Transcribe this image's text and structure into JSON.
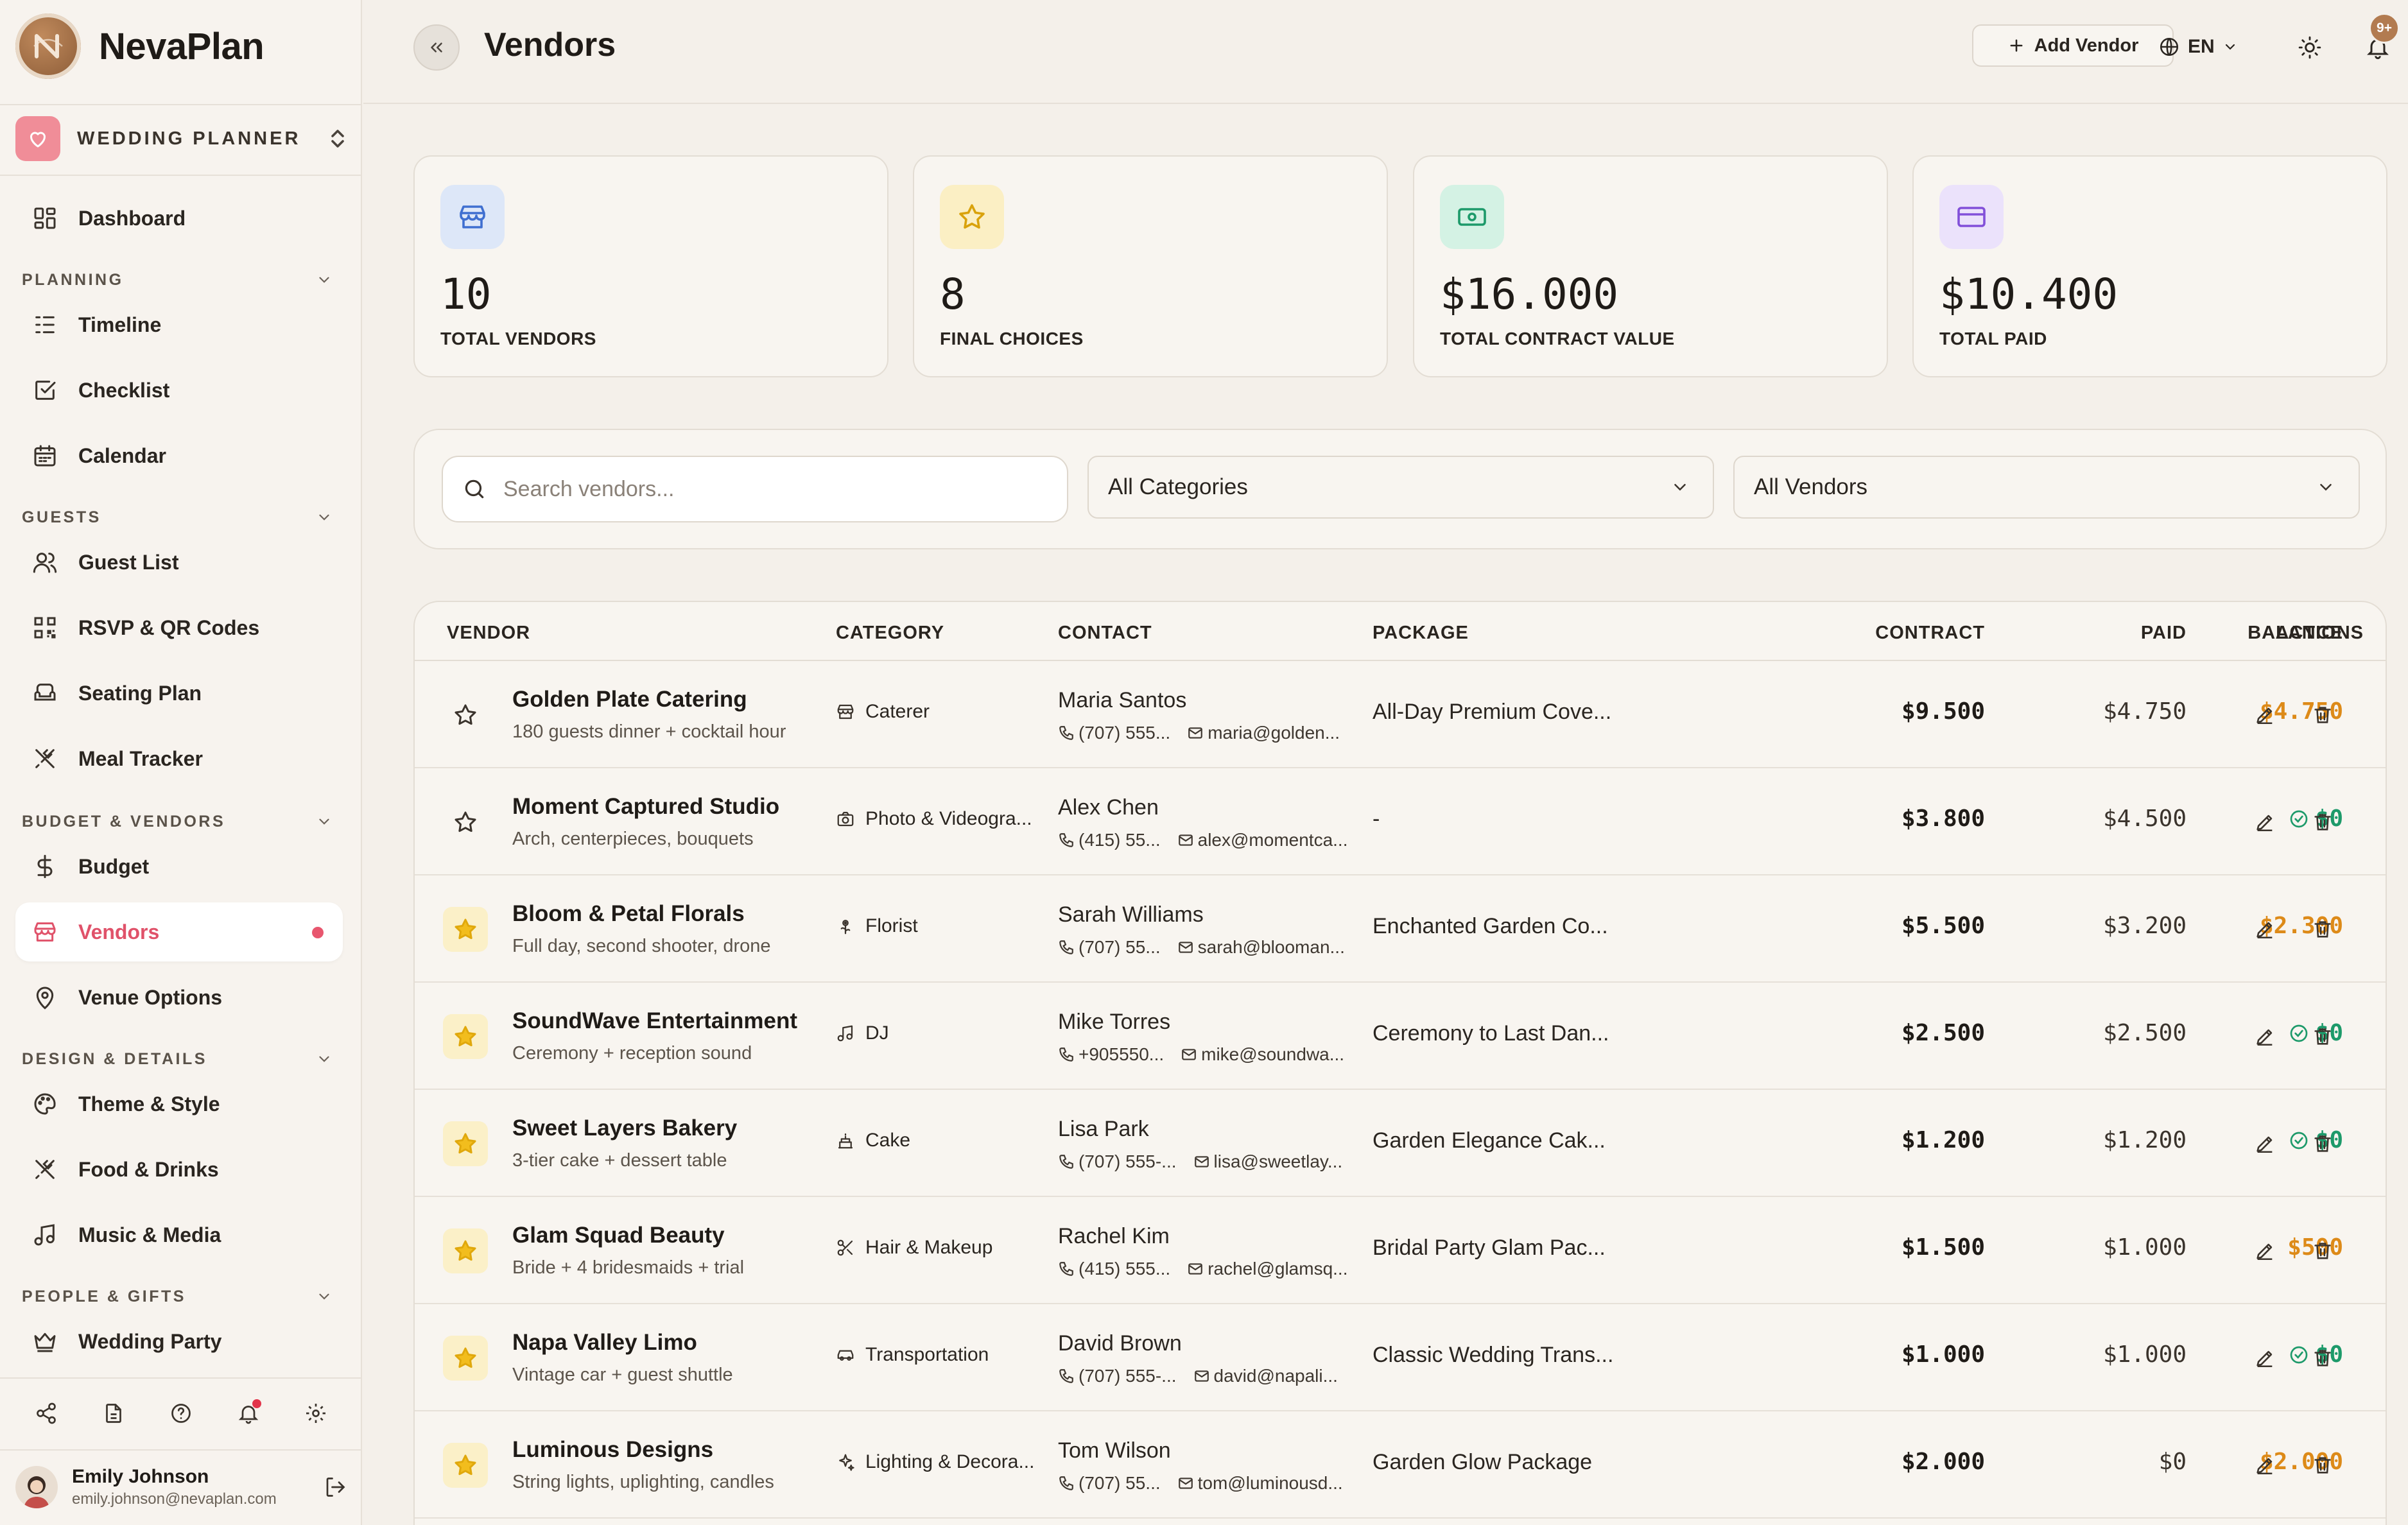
{
  "app": {
    "name": "NevaPlan",
    "project": "WEDDING PLANNER"
  },
  "sidebar": {
    "dashboard": "Dashboard",
    "sections": [
      {
        "title": "PLANNING",
        "items": [
          "Timeline",
          "Checklist",
          "Calendar"
        ]
      },
      {
        "title": "GUESTS",
        "items": [
          "Guest List",
          "RSVP & QR Codes",
          "Seating Plan",
          "Meal Tracker"
        ]
      },
      {
        "title": "BUDGET & VENDORS",
        "items": [
          "Budget",
          "Vendors",
          "Venue Options"
        ]
      },
      {
        "title": "DESIGN & DETAILS",
        "items": [
          "Theme & Style",
          "Food & Drinks",
          "Music & Media"
        ]
      },
      {
        "title": "PEOPLE & GIFTS",
        "items": [
          "Wedding Party"
        ]
      }
    ],
    "active_item": "Vendors"
  },
  "user": {
    "name": "Emily Johnson",
    "email": "emily.johnson@nevaplan.com"
  },
  "header": {
    "title": "Vendors",
    "add_button": "Add Vendor",
    "language": "EN",
    "notification_badge": "9+"
  },
  "stats": [
    {
      "value": "10",
      "label": "TOTAL VENDORS",
      "icon": "store-icon",
      "bg": "#dde7f8",
      "fg": "#3f6fd0"
    },
    {
      "value": "8",
      "label": "FINAL CHOICES",
      "icon": "star-icon",
      "bg": "#fbefc4",
      "fg": "#d9a20c"
    },
    {
      "value": "$16.000",
      "label": "TOTAL CONTRACT VALUE",
      "icon": "money-icon",
      "bg": "#d4f2e4",
      "fg": "#1d9a6a"
    },
    {
      "value": "$10.400",
      "label": "TOTAL PAID",
      "icon": "card-icon",
      "bg": "#ebe2fb",
      "fg": "#8250d9"
    }
  ],
  "filters": {
    "search_placeholder": "Search vendors...",
    "category": "All Categories",
    "status": "All Vendors"
  },
  "table": {
    "headers": {
      "vendor": "VENDOR",
      "category": "CATEGORY",
      "contact": "CONTACT",
      "package": "PACKAGE",
      "contract": "CONTRACT",
      "paid": "PAID",
      "balance": "BALANCE",
      "actions": "ACTIONS"
    },
    "rows": [
      {
        "favorite": false,
        "name": "Golden Plate Catering",
        "desc": "180 guests dinner + cocktail hour",
        "category": "Caterer",
        "cat_icon": "store-icon",
        "contact": "Maria Santos",
        "phone": "(707) 555...",
        "email": "maria@golden...",
        "package": "All-Day Premium Cove...",
        "contract": "$9.500",
        "paid": "$4.750",
        "balance": "$4.750",
        "settled": false
      },
      {
        "favorite": false,
        "name": "Moment Captured Studio",
        "desc": "Arch, centerpieces, bouquets",
        "category": "Photo & Videogra...",
        "cat_icon": "camera-icon",
        "contact": "Alex Chen",
        "phone": "(415) 55...",
        "email": "alex@momentca...",
        "package": "-",
        "contract": "$3.800",
        "paid": "$4.500",
        "balance": "$0",
        "settled": true
      },
      {
        "favorite": true,
        "name": "Bloom & Petal Florals",
        "desc": "Full day, second shooter, drone",
        "category": "Florist",
        "cat_icon": "flower-icon",
        "contact": "Sarah Williams",
        "phone": "(707) 55...",
        "email": "sarah@blooman...",
        "package": "Enchanted Garden Co...",
        "contract": "$5.500",
        "paid": "$3.200",
        "balance": "$2.300",
        "settled": false
      },
      {
        "favorite": true,
        "name": "SoundWave Entertainment",
        "desc": "Ceremony + reception sound",
        "category": "DJ",
        "cat_icon": "music-icon",
        "contact": "Mike Torres",
        "phone": "+905550...",
        "email": "mike@soundwa...",
        "package": "Ceremony to Last Dan...",
        "contract": "$2.500",
        "paid": "$2.500",
        "balance": "$0",
        "settled": true
      },
      {
        "favorite": true,
        "name": "Sweet Layers Bakery",
        "desc": "3-tier cake + dessert table",
        "category": "Cake",
        "cat_icon": "cake-icon",
        "contact": "Lisa Park",
        "phone": "(707) 555-...",
        "email": "lisa@sweetlay...",
        "package": "Garden Elegance Cak...",
        "contract": "$1.200",
        "paid": "$1.200",
        "balance": "$0",
        "settled": true
      },
      {
        "favorite": true,
        "name": "Glam Squad Beauty",
        "desc": "Bride + 4 bridesmaids + trial",
        "category": "Hair & Makeup",
        "cat_icon": "scissors-icon",
        "contact": "Rachel Kim",
        "phone": "(415) 555...",
        "email": "rachel@glamsq...",
        "package": "Bridal Party Glam Pac...",
        "contract": "$1.500",
        "paid": "$1.000",
        "balance": "$500",
        "settled": false
      },
      {
        "favorite": true,
        "name": "Napa Valley Limo",
        "desc": "Vintage car + guest shuttle",
        "category": "Transportation",
        "cat_icon": "car-icon",
        "contact": "David Brown",
        "phone": "(707) 555-...",
        "email": "david@napali...",
        "package": "Classic Wedding Trans...",
        "contract": "$1.000",
        "paid": "$1.000",
        "balance": "$0",
        "settled": true
      },
      {
        "favorite": true,
        "name": "Luminous Designs",
        "desc": "String lights, uplighting, candles",
        "category": "Lighting & Decora...",
        "cat_icon": "sparkle-icon",
        "contact": "Tom Wilson",
        "phone": "(707) 55...",
        "email": "tom@luminousd...",
        "package": "Garden Glow Package",
        "contract": "$2.000",
        "paid": "$0",
        "balance": "$2.000",
        "settled": false
      }
    ]
  },
  "colors": {
    "accent": "#e0526a",
    "balance_due": "#dd8a18",
    "balance_settled": "#1d9a6a",
    "brand": "#9a6a44"
  }
}
